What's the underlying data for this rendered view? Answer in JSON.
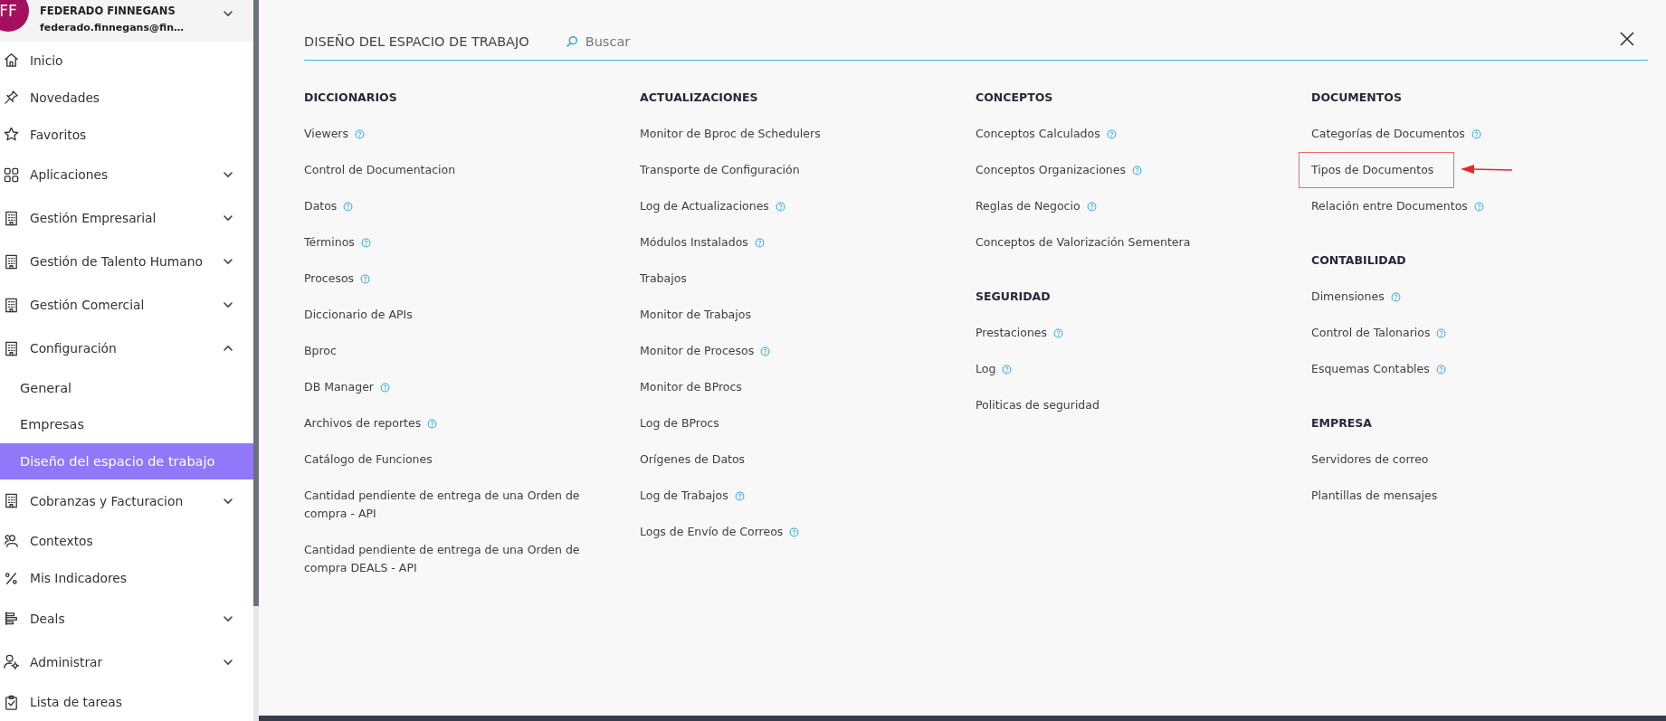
{
  "user": {
    "initials": "FF",
    "name": "FEDERADO FINNEGANS",
    "email": "federado.finnegans@fin…",
    "expanded": false
  },
  "sidebar": {
    "items": [
      {
        "label": "Inicio",
        "kind": "link"
      },
      {
        "label": "Novedades",
        "kind": "link"
      },
      {
        "label": "Favoritos",
        "kind": "link"
      },
      {
        "label": "Aplicaciones",
        "kind": "group",
        "expanded": false
      },
      {
        "label": "Gestión Empresarial",
        "kind": "group",
        "expanded": false
      },
      {
        "label": "Gestión de Talento Humano",
        "kind": "group",
        "expanded": false
      },
      {
        "label": "Gestión Comercial",
        "kind": "group",
        "expanded": false
      },
      {
        "label": "Configuración",
        "kind": "group",
        "expanded": true,
        "children": [
          {
            "label": "General",
            "selected": false
          },
          {
            "label": "Empresas",
            "selected": false
          },
          {
            "label": "Diseño del espacio de trabajo",
            "selected": true
          }
        ]
      },
      {
        "label": "Cobranzas y Facturacion",
        "kind": "group",
        "expanded": false
      },
      {
        "label": "Contextos",
        "kind": "link"
      },
      {
        "label": "Mis Indicadores",
        "kind": "link"
      },
      {
        "label": "Deals",
        "kind": "group",
        "expanded": false
      },
      {
        "label": "Administrar",
        "kind": "group",
        "expanded": false
      },
      {
        "label": "Lista de tareas",
        "kind": "link"
      }
    ]
  },
  "panel": {
    "title": "DISEÑO DEL ESPACIO DE TRABAJO",
    "search": {
      "placeholder": "Buscar"
    },
    "columns": [
      {
        "sections": [
          {
            "title": "DICCIONARIOS",
            "items": [
              {
                "label": "Viewers",
                "help": true
              },
              {
                "label": "Control de Documentacion",
                "help": false
              },
              {
                "label": "Datos",
                "help": true
              },
              {
                "label": "Términos",
                "help": true
              },
              {
                "label": "Procesos",
                "help": true
              },
              {
                "label": "Diccionario de APIs",
                "help": false
              },
              {
                "label": "Bproc",
                "help": false
              },
              {
                "label": "DB Manager",
                "help": true
              },
              {
                "label": "Archivos de reportes",
                "help": true
              },
              {
                "label": "Catálogo de Funciones",
                "help": false
              },
              {
                "label": "Cantidad pendiente de entrega de una Orden de compra - API",
                "help": false
              },
              {
                "label": "Cantidad pendiente de entrega de una Orden de compra DEALS - API",
                "help": false
              }
            ]
          }
        ]
      },
      {
        "sections": [
          {
            "title": "ACTUALIZACIONES",
            "items": [
              {
                "label": "Monitor de Bproc de Schedulers",
                "help": false
              },
              {
                "label": "Transporte de Configuración",
                "help": false
              },
              {
                "label": "Log de Actualizaciones",
                "help": true
              },
              {
                "label": "Módulos Instalados",
                "help": true
              },
              {
                "label": "Trabajos",
                "help": false
              },
              {
                "label": "Monitor de Trabajos",
                "help": false
              },
              {
                "label": "Monitor de Procesos",
                "help": true
              },
              {
                "label": "Monitor de BProcs",
                "help": false
              },
              {
                "label": "Log de BProcs",
                "help": false
              },
              {
                "label": "Orígenes de Datos",
                "help": false
              },
              {
                "label": "Log de Trabajos",
                "help": true
              },
              {
                "label": "Logs de Envío de Correos",
                "help": true
              }
            ]
          }
        ]
      },
      {
        "sections": [
          {
            "title": "CONCEPTOS",
            "items": [
              {
                "label": "Conceptos Calculados",
                "help": true
              },
              {
                "label": "Conceptos Organizaciones",
                "help": true
              },
              {
                "label": "Reglas de Negocio",
                "help": true
              },
              {
                "label": "Conceptos de Valorización Sementera",
                "help": false
              }
            ]
          },
          {
            "title": "SEGURIDAD",
            "items": [
              {
                "label": "Prestaciones",
                "help": true
              },
              {
                "label": "Log",
                "help": true
              },
              {
                "label": "Politicas de seguridad",
                "help": false
              }
            ]
          }
        ]
      },
      {
        "sections": [
          {
            "title": "DOCUMENTOS",
            "items": [
              {
                "label": "Categorías de Documentos",
                "help": true
              },
              {
                "label": "Tipos de Documentos",
                "help": false,
                "annotated": true
              },
              {
                "label": "Relación entre Documentos",
                "help": true
              }
            ]
          },
          {
            "title": "CONTABILIDAD",
            "items": [
              {
                "label": "Dimensiones",
                "help": true
              },
              {
                "label": "Control de Talonarios",
                "help": true
              },
              {
                "label": "Esquemas Contables",
                "help": true
              }
            ]
          },
          {
            "title": "EMPRESA",
            "items": [
              {
                "label": "Servidores de correo",
                "help": false
              },
              {
                "label": "Plantillas de mensajes",
                "help": false
              }
            ]
          }
        ]
      }
    ]
  }
}
